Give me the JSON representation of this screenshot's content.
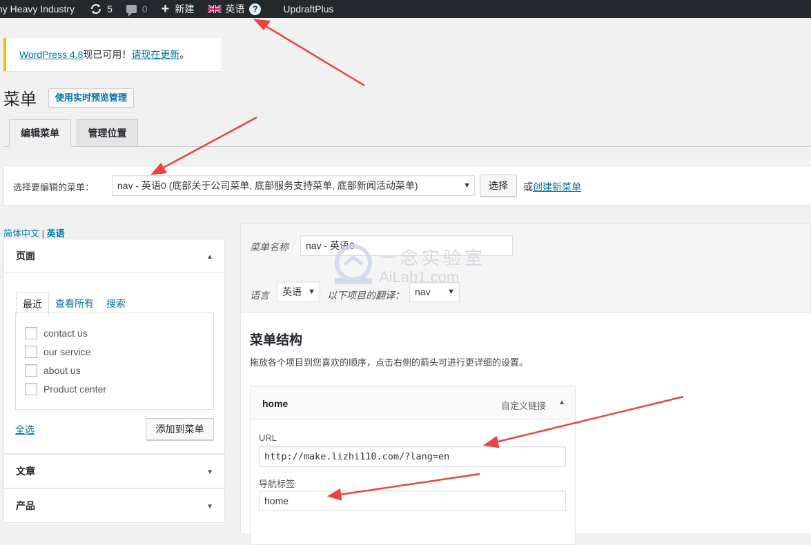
{
  "adminbar": {
    "site_name": "ny Heavy Industry",
    "updates_count": "5",
    "comments_count": "0",
    "new_label": "新建",
    "language": "英语",
    "help_icon": "?",
    "updraft": "UpdraftPlus"
  },
  "notice": {
    "link1": "WordPress 4.8",
    "mid": "现已可用！",
    "link2": "请现在更新",
    "end": "。"
  },
  "page": {
    "title": "菜单",
    "preview_button": "使用实时预览管理"
  },
  "tabs": [
    "编辑菜单",
    "管理位置"
  ],
  "menu_select": {
    "label": "选择要编辑的菜单：",
    "value": "nav - 英语0 (底部关于公司菜单, 底部服务支持菜单, 底部新闻活动菜单)",
    "button": "选择",
    "or_text": "或",
    "create_link": "创建新菜单"
  },
  "lang_switch": {
    "item1": "简体中文",
    "sep": " | ",
    "item2": "英语"
  },
  "pages_box": {
    "title": "页面",
    "subtabs": [
      "最近",
      "查看所有",
      "搜索"
    ],
    "items": [
      "contact us",
      "our service",
      "about us",
      "Product center"
    ],
    "select_all": "全选",
    "add_button": "添加到菜单"
  },
  "accordion": {
    "posts": "文章",
    "products": "产品"
  },
  "menu_settings": {
    "name_label": "菜单名称",
    "name_value": "nav - 英语0",
    "lang_label": "语言",
    "lang_value": "英语",
    "trans_label": "以下项目的翻译：",
    "trans_value": "nav"
  },
  "structure": {
    "title": "菜单结构",
    "desc": "拖放各个项目到您喜欢的顺序，点击右侧的箭头可进行更详细的设置。",
    "item_title": "home",
    "item_type": "自定义链接",
    "url_label": "URL",
    "url_value": "http://make.lizhi110.com/?lang=en",
    "nav_label": "导航标签",
    "nav_value": "home"
  },
  "watermark": {
    "cn": "一念实验室",
    "en": "AiLab1.com"
  },
  "colors": {
    "adminbar": "#23282d",
    "link": "#0073aa",
    "notice_border": "#ffb900",
    "annotation_arrow": "#e8453c"
  }
}
